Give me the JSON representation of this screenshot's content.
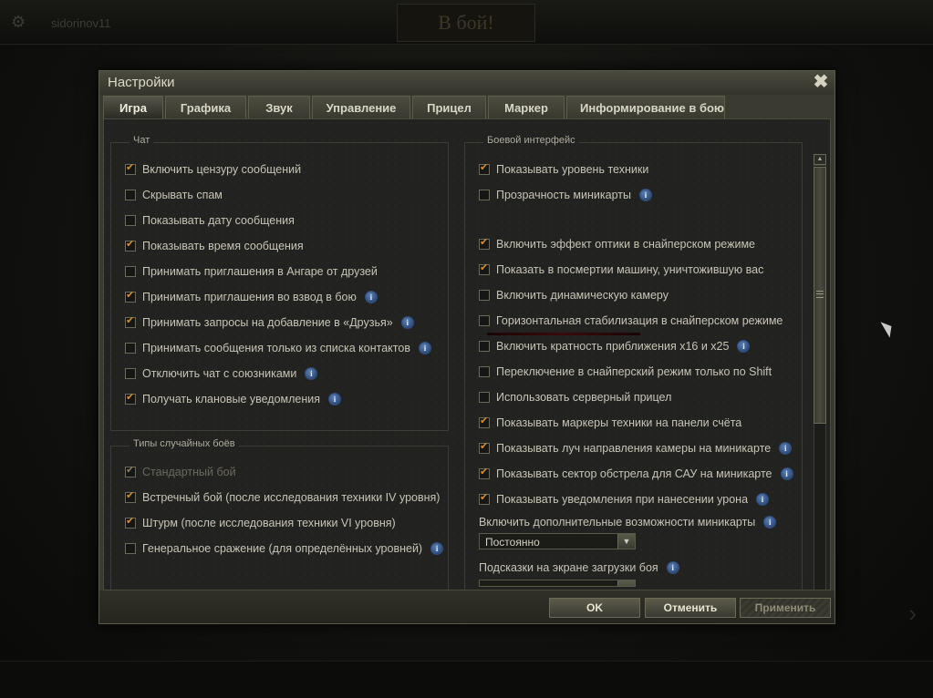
{
  "background": {
    "username": "sidorinov11",
    "battle_button": "В бой!"
  },
  "dialog": {
    "title": "Настройки",
    "tabs": [
      {
        "label": "Игра",
        "active": true
      },
      {
        "label": "Графика"
      },
      {
        "label": "Звук"
      },
      {
        "label": "Управление"
      },
      {
        "label": "Прицел"
      },
      {
        "label": "Маркер"
      },
      {
        "label": "Информирование в бою"
      }
    ],
    "chat": {
      "title": "Чат",
      "items": [
        {
          "label": "Включить цензуру сообщений",
          "checked": true,
          "info": false
        },
        {
          "label": "Скрывать спам",
          "checked": false,
          "info": false
        },
        {
          "label": "Показывать дату сообщения",
          "checked": false,
          "info": false
        },
        {
          "label": "Показывать время сообщения",
          "checked": true,
          "info": false
        },
        {
          "label": "Принимать приглашения в Ангаре от друзей",
          "checked": false,
          "info": false
        },
        {
          "label": "Принимать приглашения во взвод в бою",
          "checked": true,
          "info": true
        },
        {
          "label": "Принимать запросы на добавление в «Друзья»",
          "checked": true,
          "info": true
        },
        {
          "label": "Принимать сообщения только из списка контактов",
          "checked": false,
          "info": true
        },
        {
          "label": "Отключить чат с союзниками",
          "checked": false,
          "info": true
        },
        {
          "label": "Получать клановые уведомления",
          "checked": true,
          "info": true
        }
      ]
    },
    "battle_types": {
      "title": "Типы случайных боёв",
      "items": [
        {
          "label": "Стандартный бой",
          "checked": true,
          "disabled": true,
          "info": false
        },
        {
          "label": "Встречный бой (после исследования техники IV уровня)",
          "checked": true,
          "info": false
        },
        {
          "label": "Штурм (после исследования техники VI уровня)",
          "checked": true,
          "info": false
        },
        {
          "label": "Генеральное сражение (для определённых уровней)",
          "checked": false,
          "info": true
        }
      ]
    },
    "battle_interface": {
      "title": "Боевой интерфейс",
      "items_top": [
        {
          "label": "Показывать уровень техники",
          "checked": true,
          "info": false
        },
        {
          "label": "Прозрачность миникарты",
          "checked": false,
          "info": true
        }
      ],
      "items": [
        {
          "label": "Включить эффект оптики в снайперском режиме",
          "checked": true,
          "info": false
        },
        {
          "label": "Показать в посмертии машину, уничтожившую вас",
          "checked": true,
          "info": false
        },
        {
          "label": "Включить динамическую камеру",
          "checked": false,
          "info": false
        },
        {
          "label": "Горизонтальная стабилизация в снайперском режиме",
          "checked": false,
          "info": false
        },
        {
          "label": "Включить кратность приближения x16 и x25",
          "checked": false,
          "info": true
        },
        {
          "label": "Переключение в снайперский режим только по Shift",
          "checked": false,
          "info": false
        },
        {
          "label": "Использовать серверный прицел",
          "checked": false,
          "info": false
        },
        {
          "label": "Показывать маркеры техники на панели счёта",
          "checked": true,
          "info": false
        },
        {
          "label": "Показывать луч направления камеры на миникарте",
          "checked": true,
          "info": true
        },
        {
          "label": "Показывать сектор обстрела для САУ на миникарте",
          "checked": true,
          "info": true
        },
        {
          "label": "Показывать уведомления при нанесении урона",
          "checked": true,
          "info": true
        }
      ],
      "minimap_extra_label": "Включить дополнительные возможности миникарты",
      "minimap_extra_value": "Постоянно",
      "loading_hints_label": "Подсказки на экране загрузки боя"
    },
    "buttons": {
      "ok": "OK",
      "cancel": "Отменить",
      "apply": "Применить"
    },
    "info_glyph": "i"
  }
}
